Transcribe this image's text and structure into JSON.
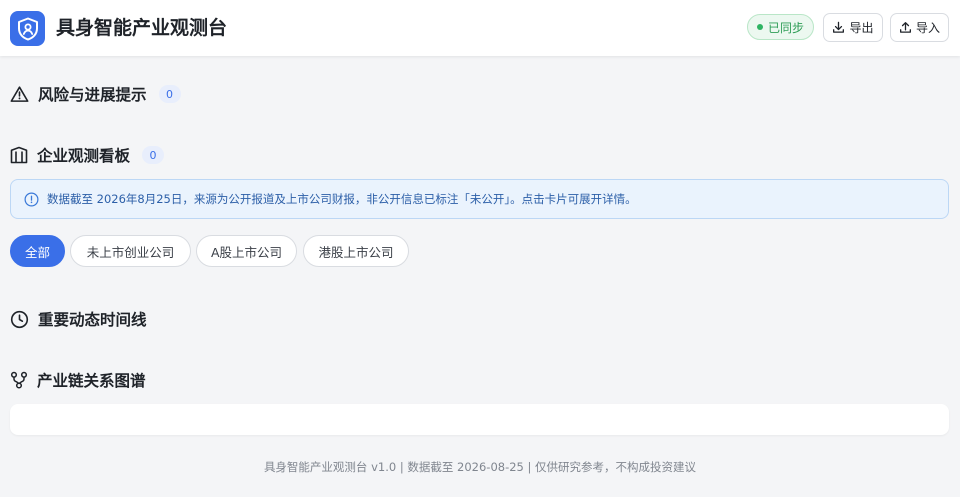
{
  "header": {
    "title": "具身智能产业观测台",
    "sync_status": "已同步",
    "export_label": "导出",
    "import_label": "导入"
  },
  "sections": {
    "risk": {
      "title": "风险与进展提示",
      "count": "0"
    },
    "board": {
      "title": "企业观测看板",
      "count": "0"
    },
    "timeline": {
      "title": "重要动态时间线"
    },
    "graph": {
      "title": "产业链关系图谱"
    }
  },
  "info_banner": "数据截至 2026年8月25日，来源为公开报道及上市公司财报，非公开信息已标注「未公开」。点击卡片可展开详情。",
  "filters": [
    "全部",
    "未上市创业公司",
    "A股上市公司",
    "港股上市公司"
  ],
  "footer": "具身智能产业观测台 v1.0 | 数据截至 2026-08-25 | 仅供研究参考，不构成投资建议",
  "colors": {
    "accent": "#3a6fe8",
    "sync_green": "#2fb463",
    "info_bg": "#eaf3fd",
    "page_bg": "#f4f5f7"
  }
}
